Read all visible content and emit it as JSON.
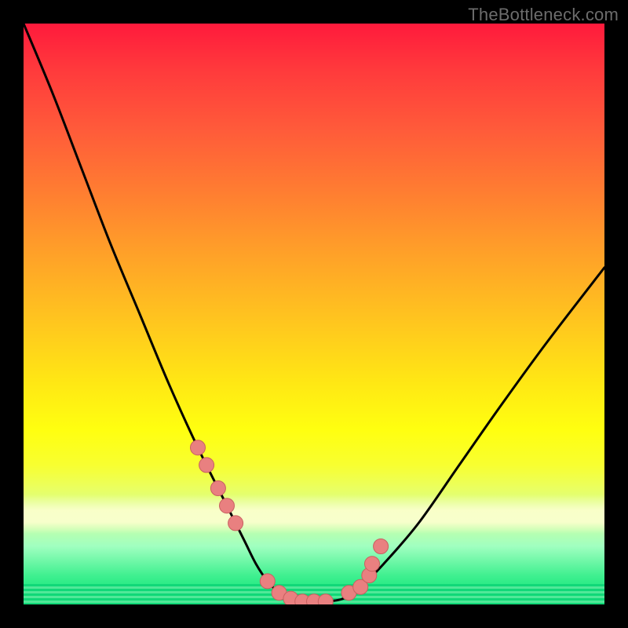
{
  "watermark": "TheBottleneck.com",
  "colors": {
    "frame": "#000000",
    "curve": "#000000",
    "marker_fill": "#e98080",
    "marker_stroke": "#c86060"
  },
  "chart_data": {
    "type": "line",
    "title": "",
    "xlabel": "",
    "ylabel": "",
    "xlim": [
      0,
      100
    ],
    "ylim": [
      0,
      100
    ],
    "x": [
      0,
      5,
      10,
      15,
      20,
      25,
      30,
      35,
      38,
      40,
      42,
      44,
      46,
      48,
      50,
      52,
      55,
      58,
      62,
      68,
      75,
      82,
      90,
      100
    ],
    "values": [
      100,
      88,
      75,
      62,
      50,
      38,
      27,
      17,
      11,
      7,
      4,
      2,
      1,
      0.5,
      0.5,
      0.5,
      1,
      3,
      7,
      14,
      24,
      34,
      45,
      58
    ],
    "marker_points": {
      "x": [
        30,
        31.5,
        33.5,
        35,
        36.5,
        42,
        44,
        46,
        48,
        50,
        52,
        56,
        58,
        59.5,
        60,
        61.5
      ],
      "y": [
        27,
        24,
        20,
        17,
        14,
        4,
        2,
        1,
        0.5,
        0.5,
        0.5,
        2,
        3,
        5,
        7,
        10
      ]
    }
  }
}
